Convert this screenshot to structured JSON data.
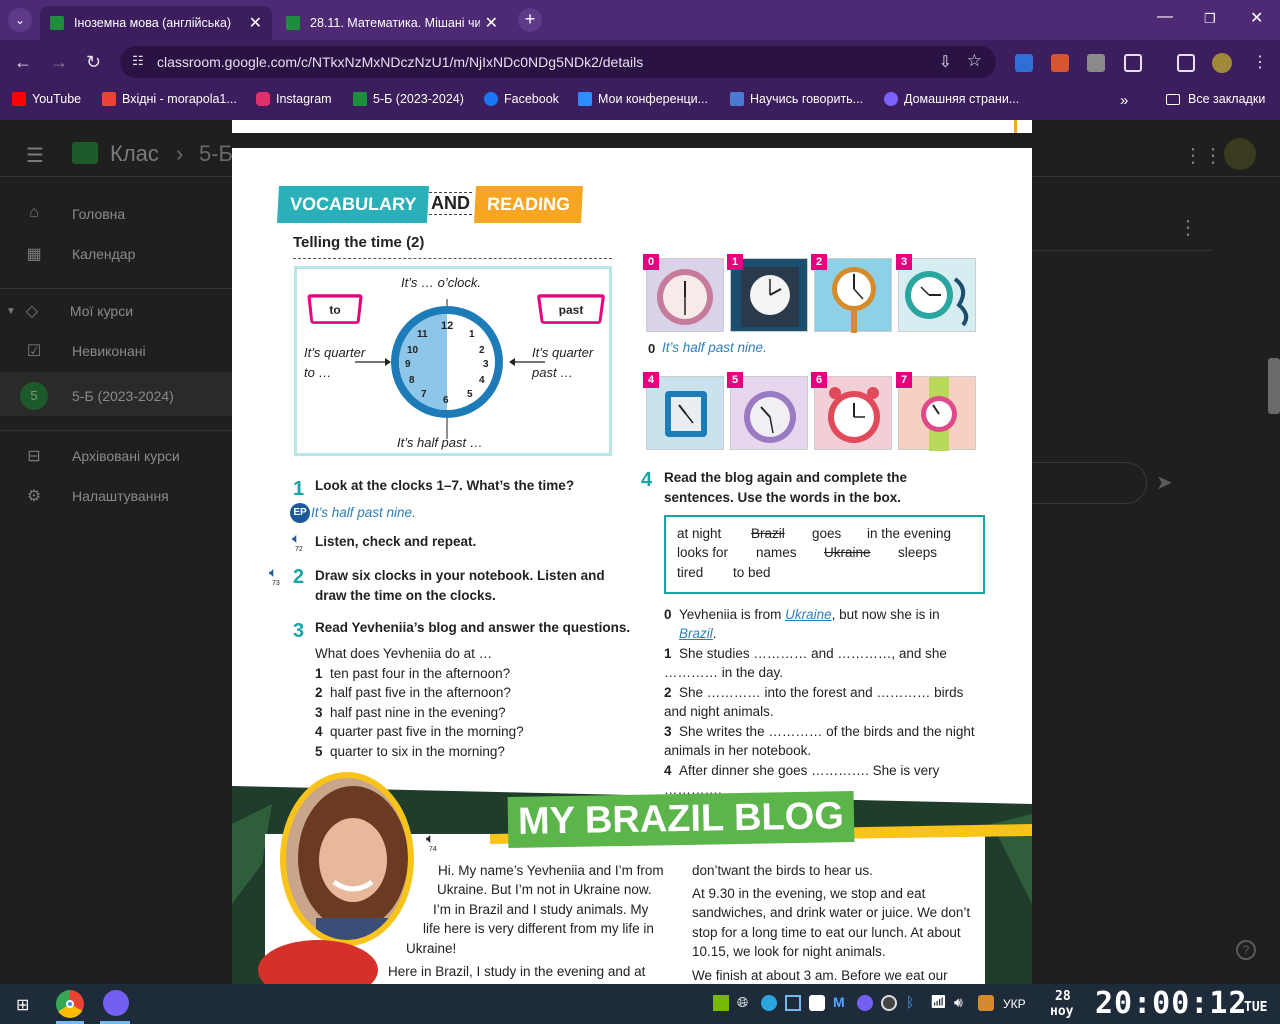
{
  "browser": {
    "tabs": [
      {
        "title": "Іноземна мова (англійська)",
        "active": true
      },
      {
        "title": "28.11. Математика. Мішані чи",
        "active": false
      }
    ],
    "url": "classroom.google.com/c/NTkxNzMxNDczNzU1/m/NjIxNDc0NDg5NDk2/details",
    "bookmarks": [
      {
        "label": "YouTube",
        "color": "#ff0000"
      },
      {
        "label": "Вхідні - morapola1...",
        "color": "#ea4335"
      },
      {
        "label": "Instagram",
        "color": "#e1306c"
      },
      {
        "label": "5-Б (2023-2024)",
        "color": "#1e8e3e"
      },
      {
        "label": "Facebook",
        "color": "#1877f2"
      },
      {
        "label": "Мои конференци...",
        "color": "#2d8cff"
      },
      {
        "label": "Научись говорить...",
        "color": "#4a7bd0"
      },
      {
        "label": "Домашняя страни...",
        "color": "#7b61ff"
      }
    ],
    "all_bookmarks": "Все закладки",
    "more_bookmarks": "»"
  },
  "classroom": {
    "title": "Клас",
    "breadcrumb": "5-Б (2023-2024)",
    "sidebar": [
      {
        "label": "Головна",
        "icon": "home-icon"
      },
      {
        "label": "Календар",
        "icon": "calendar-icon"
      },
      {
        "label": "Мої курси",
        "icon": "school-icon"
      },
      {
        "label": "Невиконані",
        "icon": "todo-icon"
      },
      {
        "label": "5-Б (2023-2024)",
        "icon": "class-avatar",
        "avatar": "5"
      },
      {
        "label": "Архівовані курси",
        "icon": "archive-icon"
      },
      {
        "label": "Налаштування",
        "icon": "settings-icon"
      }
    ]
  },
  "document": {
    "banner": {
      "vocab": "VOCABULARY",
      "and": "AND",
      "reading": "READING"
    },
    "section_title": "Telling the time (2)",
    "clock_diagram": {
      "oclock": "It’s … o’clock.",
      "to": "to",
      "past": "past",
      "quarter_to": "It’s quarter to …",
      "quarter_past": "It’s quarter past …",
      "half_past": "It’s half past …"
    },
    "ex1": {
      "num": "1",
      "instruction": "Look at the clocks 1–7. What’s the time?",
      "ep": "EP",
      "example": "It’s half past nine.",
      "listen": "Listen, check and repeat.",
      "track": "72"
    },
    "ex2": {
      "num": "2",
      "instruction": "Draw six clocks in your notebook. Listen and draw the time on the clocks.",
      "track": "73"
    },
    "ex3": {
      "num": "3",
      "instruction": "Read Yevheniia’s blog and answer the questions.",
      "lead": "What does Yevheniia do at …",
      "items": [
        {
          "n": "1",
          "text": "ten past four in the afternoon?"
        },
        {
          "n": "2",
          "text": "half past five in the afternoon?"
        },
        {
          "n": "3",
          "text": "half past nine in the evening?"
        },
        {
          "n": "4",
          "text": "quarter past five in the morning?"
        },
        {
          "n": "5",
          "text": "quarter to six in the morning?"
        }
      ]
    },
    "clocks": {
      "labels": [
        "0",
        "1",
        "2",
        "3",
        "4",
        "5",
        "6",
        "7"
      ],
      "example": "It’s half past nine.",
      "example_n": "0"
    },
    "ex4": {
      "num": "4",
      "instruction": "Read the blog again and complete the sentences. Use the words in the box.",
      "words_row1": [
        "at night",
        "Brazil",
        "goes",
        "in the evening"
      ],
      "words_row2": [
        "looks for",
        "names",
        "Ukraine",
        "sleeps"
      ],
      "words_row3": [
        "tired",
        "to bed"
      ],
      "items": [
        {
          "n": "0",
          "a": "Yevheniia is from ",
          "ans1": "Ukraine",
          "b": ", but now she is in",
          "ans2": "Brazil",
          "c": "."
        },
        {
          "n": "1",
          "text": "She studies ………… and …………, and she ………… in the day."
        },
        {
          "n": "2",
          "text": "She ………… into the forest and ………… birds and night animals."
        },
        {
          "n": "3",
          "text": "She writes the ………… of the birds and the night animals in her notebook."
        },
        {
          "n": "4",
          "text": "After dinner she goes …………. She is very …………."
        }
      ]
    },
    "blog": {
      "title": "MY BRAZIL BLOG",
      "track": "74",
      "left": [
        "Hi. My name’s Yevheniia and I’m from",
        "Ukraine. But I’m not in Ukraine now.",
        "I’m in Brazil and I study animals. My",
        "life here is very different from my life in",
        "Ukraine!",
        "Here in Brazil, I study in the evening and at"
      ],
      "right": [
        "don’twant the birds to hear us.",
        "At 9.30 in the evening, we stop and eat",
        "sandwiches, and drink water or juice. We don’t",
        "stop for a long time to eat our lunch. At about",
        "10.15, we look for night animals.",
        "We finish at about 3 am. Before we eat our"
      ]
    }
  },
  "taskbar": {
    "lang": "УКР",
    "date_day": "28",
    "date_month": "ноу",
    "time": "20:00:12",
    "weekday": "TUE"
  }
}
